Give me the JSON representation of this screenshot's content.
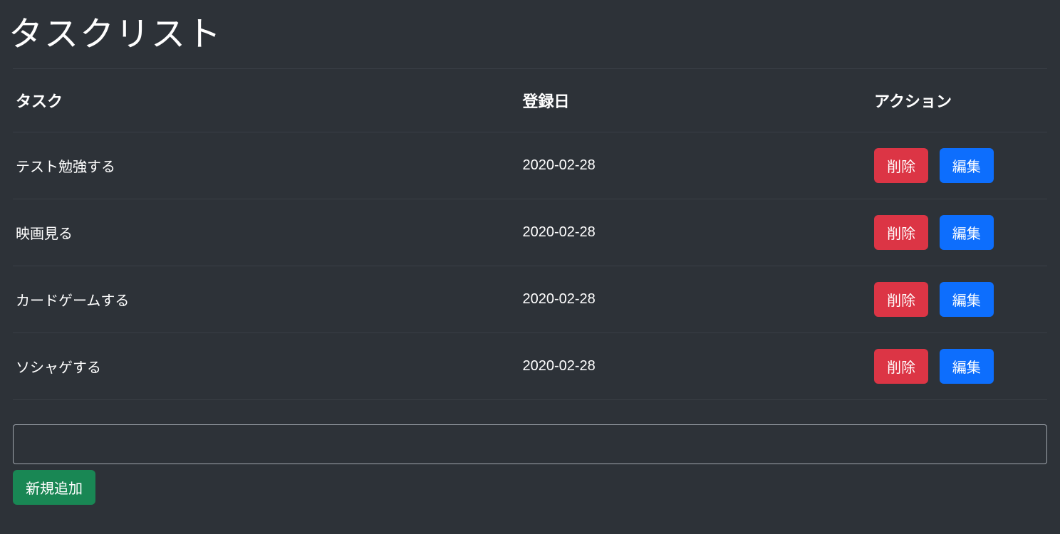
{
  "title": "タスクリスト",
  "columns": {
    "task": "タスク",
    "date": "登録日",
    "action": "アクション"
  },
  "buttons": {
    "delete": "削除",
    "edit": "編集",
    "add": "新規追加"
  },
  "newTask": {
    "value": ""
  },
  "tasks": [
    {
      "name": "テスト勉強する",
      "date": "2020-02-28"
    },
    {
      "name": "映画見る",
      "date": "2020-02-28"
    },
    {
      "name": "カードゲームする",
      "date": "2020-02-28"
    },
    {
      "name": "ソシャゲする",
      "date": "2020-02-28"
    }
  ]
}
